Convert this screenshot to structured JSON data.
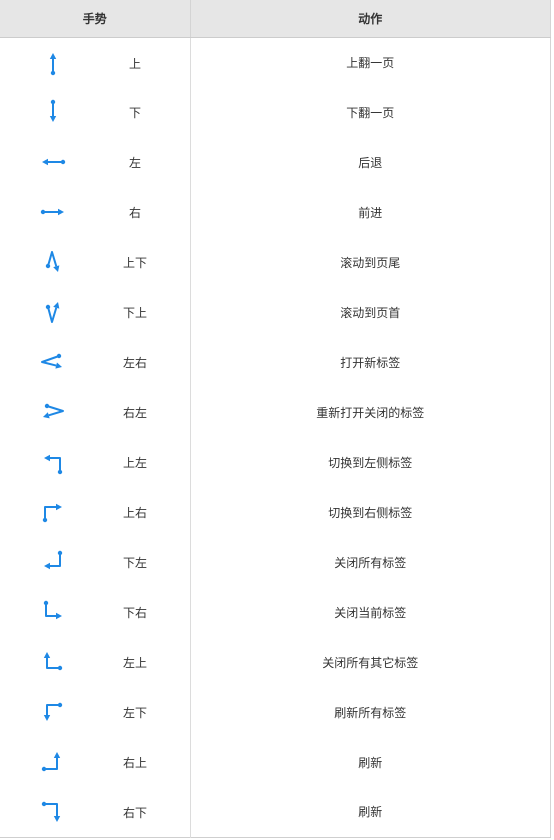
{
  "header": {
    "gesture_label": "手势",
    "action_label": "动作"
  },
  "accent_color": "#1e88e5",
  "rows": [
    {
      "icon": "arrow-up-icon",
      "gesture": "上",
      "action": "上翻一页"
    },
    {
      "icon": "arrow-down-icon",
      "gesture": "下",
      "action": "下翻一页"
    },
    {
      "icon": "arrow-left-icon",
      "gesture": "左",
      "action": "后退"
    },
    {
      "icon": "arrow-right-icon",
      "gesture": "右",
      "action": "前进"
    },
    {
      "icon": "gesture-up-down-icon",
      "gesture": "上下",
      "action": "滚动到页尾"
    },
    {
      "icon": "gesture-down-up-icon",
      "gesture": "下上",
      "action": "滚动到页首"
    },
    {
      "icon": "gesture-left-right-icon",
      "gesture": "左右",
      "action": "打开新标签"
    },
    {
      "icon": "gesture-right-left-icon",
      "gesture": "右左",
      "action": "重新打开关闭的标签"
    },
    {
      "icon": "gesture-up-left-icon",
      "gesture": "上左",
      "action": "切换到左侧标签"
    },
    {
      "icon": "gesture-up-right-icon",
      "gesture": "上右",
      "action": "切换到右侧标签"
    },
    {
      "icon": "gesture-down-left-icon",
      "gesture": "下左",
      "action": "关闭所有标签"
    },
    {
      "icon": "gesture-down-right-icon",
      "gesture": "下右",
      "action": "关闭当前标签"
    },
    {
      "icon": "gesture-left-up-icon",
      "gesture": "左上",
      "action": "关闭所有其它标签"
    },
    {
      "icon": "gesture-left-down-icon",
      "gesture": "左下",
      "action": "刷新所有标签"
    },
    {
      "icon": "gesture-right-up-icon",
      "gesture": "右上",
      "action": "刷新"
    },
    {
      "icon": "gesture-right-down-icon",
      "gesture": "右下",
      "action": "刷新"
    }
  ]
}
